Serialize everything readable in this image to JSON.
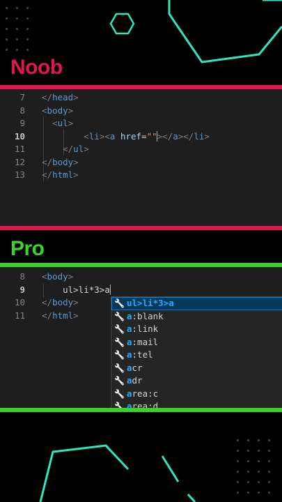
{
  "labels": {
    "noob": "Noob",
    "pro": "Pro"
  },
  "colors": {
    "noob": "#e0174f",
    "pro": "#39d42a",
    "accent": "#2ee6c0"
  },
  "noob_editor": {
    "line_numbers": [
      "7",
      "8",
      "9",
      "10",
      "11",
      "12",
      "13"
    ],
    "current_line": "10"
  },
  "pro_editor": {
    "line_numbers": [
      "8",
      "9",
      "10",
      "11"
    ],
    "current_line": "9",
    "typed": "ul>li*3>a"
  },
  "suggestions": {
    "items": [
      {
        "match": "ul>li*3>a",
        "rest": ""
      },
      {
        "match": "a",
        "rest": ":blank"
      },
      {
        "match": "a",
        "rest": ":link"
      },
      {
        "match": "a",
        "rest": ":mail"
      },
      {
        "match": "a",
        "rest": ":tel"
      },
      {
        "match": "a",
        "rest": "cr"
      },
      {
        "match": "a",
        "rest": "dr"
      },
      {
        "match": "a",
        "rest": "rea:c"
      },
      {
        "match": "a",
        "rest": "rea:d"
      }
    ],
    "icon": "wrench-icon"
  }
}
